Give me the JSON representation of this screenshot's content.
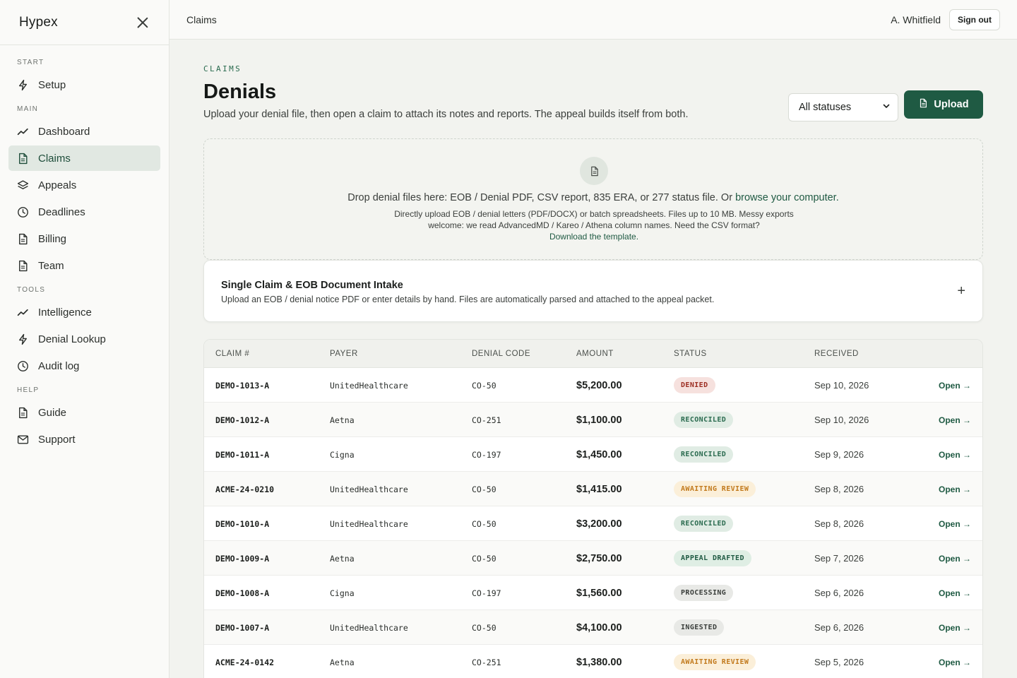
{
  "app": {
    "brand": "Hypex"
  },
  "sidebar": {
    "sections": [
      {
        "label": "START",
        "items": [
          {
            "label": "Setup",
            "icon": "bolt-icon"
          }
        ]
      },
      {
        "label": "MAIN",
        "items": [
          {
            "label": "Dashboard",
            "icon": "trend-icon"
          },
          {
            "label": "Claims",
            "icon": "document-icon",
            "active": true
          },
          {
            "label": "Appeals",
            "icon": "layers-icon"
          },
          {
            "label": "Deadlines",
            "icon": "clock-icon"
          },
          {
            "label": "Billing",
            "icon": "document-icon"
          },
          {
            "label": "Team",
            "icon": "document-icon"
          }
        ]
      },
      {
        "label": "TOOLS",
        "items": [
          {
            "label": "Intelligence",
            "icon": "trend-icon"
          },
          {
            "label": "Denial Lookup",
            "icon": "bolt-icon"
          },
          {
            "label": "Audit log",
            "icon": "clock-icon"
          }
        ]
      },
      {
        "label": "HELP",
        "items": [
          {
            "label": "Guide",
            "icon": "document-icon"
          },
          {
            "label": "Support",
            "icon": "mail-icon"
          }
        ]
      }
    ]
  },
  "topbar": {
    "title": "Claims",
    "user": "A. Whitfield",
    "signout_label": "Sign out"
  },
  "page": {
    "eyebrow": "CLAIMS",
    "title": "Denials",
    "subtitle": "Upload your denial file, then open a claim to attach its notes and reports. The appeal builds itself from both.",
    "status_filter": "All statuses",
    "upload_label": "Upload"
  },
  "dropzone": {
    "main_text": "Drop denial files here: EOB / Denial PDF, CSV report, 835 ERA, or 277 status file. Or ",
    "browse_link": "browse your computer.",
    "detail_text": "Directly upload EOB / denial letters (PDF/DOCX) or batch spreadsheets. Files up to 10 MB. Messy exports welcome: we read AdvancedMD / Kareo / Athena column names. Need the CSV format?",
    "template_link": "Download the template."
  },
  "intake": {
    "title": "Single Claim & EOB Document Intake",
    "subtitle": "Upload an EOB / denial notice PDF or enter details by hand. Files are automatically parsed and attached to the appeal packet.",
    "toggle": "+"
  },
  "table": {
    "headers": {
      "claim": "CLAIM #",
      "payer": "PAYER",
      "code": "DENIAL CODE",
      "amount": "AMOUNT",
      "status": "STATUS",
      "received": "RECEIVED"
    },
    "open_label": "Open →",
    "rows": [
      {
        "claim": "DEMO-1013-A",
        "payer": "UnitedHealthcare",
        "code": "CO-50",
        "amount": "$5,200.00",
        "status": "DENIED",
        "status_kind": "denied",
        "received": "Sep 10, 2026"
      },
      {
        "claim": "DEMO-1012-A",
        "payer": "Aetna",
        "code": "CO-251",
        "amount": "$1,100.00",
        "status": "RECONCILED",
        "status_kind": "reconciled",
        "received": "Sep 10, 2026"
      },
      {
        "claim": "DEMO-1011-A",
        "payer": "Cigna",
        "code": "CO-197",
        "amount": "$1,450.00",
        "status": "RECONCILED",
        "status_kind": "reconciled",
        "received": "Sep 9, 2026"
      },
      {
        "claim": "ACME-24-0210",
        "payer": "UnitedHealthcare",
        "code": "CO-50",
        "amount": "$1,415.00",
        "status": "AWAITING REVIEW",
        "status_kind": "awaiting",
        "received": "Sep 8, 2026"
      },
      {
        "claim": "DEMO-1010-A",
        "payer": "UnitedHealthcare",
        "code": "CO-50",
        "amount": "$3,200.00",
        "status": "RECONCILED",
        "status_kind": "reconciled",
        "received": "Sep 8, 2026"
      },
      {
        "claim": "DEMO-1009-A",
        "payer": "Aetna",
        "code": "CO-50",
        "amount": "$2,750.00",
        "status": "APPEAL DRAFTED",
        "status_kind": "drafted",
        "received": "Sep 7, 2026"
      },
      {
        "claim": "DEMO-1008-A",
        "payer": "Cigna",
        "code": "CO-197",
        "amount": "$1,560.00",
        "status": "PROCESSING",
        "status_kind": "processing",
        "received": "Sep 6, 2026"
      },
      {
        "claim": "DEMO-1007-A",
        "payer": "UnitedHealthcare",
        "code": "CO-50",
        "amount": "$4,100.00",
        "status": "INGESTED",
        "status_kind": "ingested",
        "received": "Sep 6, 2026"
      },
      {
        "claim": "ACME-24-0142",
        "payer": "Aetna",
        "code": "CO-251",
        "amount": "$1,380.00",
        "status": "AWAITING REVIEW",
        "status_kind": "awaiting",
        "received": "Sep 5, 2026"
      }
    ]
  },
  "colors": {
    "accent": "#1f5a43",
    "active_nav_bg": "#e1e8e2",
    "page_bg": "#f2f3ef"
  }
}
